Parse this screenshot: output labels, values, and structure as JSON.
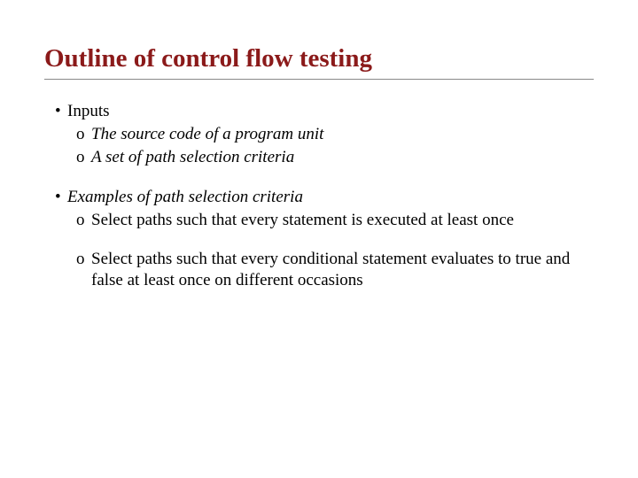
{
  "title": "Outline of control flow testing",
  "items": [
    {
      "text": "Inputs",
      "italic": false,
      "sub": [
        {
          "text": "The source code of a program unit",
          "italic": true,
          "spaced": false
        },
        {
          "text": "A set of path selection criteria",
          "italic": true,
          "spaced": false
        }
      ]
    },
    {
      "text": "Examples of path selection criteria",
      "italic": true,
      "sub": [
        {
          "text": "Select paths such that every statement is executed at least once",
          "italic": false,
          "spaced": true
        },
        {
          "text": "Select paths such that every conditional statement evaluates to true and false at least once on different occasions",
          "italic": false,
          "spaced": true
        }
      ]
    }
  ]
}
